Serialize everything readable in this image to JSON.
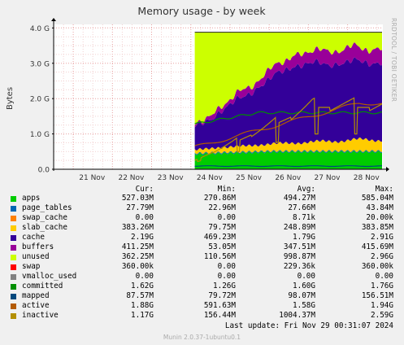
{
  "chart_data": {
    "type": "area",
    "title": "Memory usage - by week",
    "ylabel": "Bytes",
    "ylim": [
      0,
      4.1
    ],
    "y_unit": "G",
    "y_ticks": [
      "0.0",
      "1.0 G",
      "2.0 G",
      "3.0 G",
      "4.0 G"
    ],
    "x_ticks": [
      "21 Nov",
      "22 Nov",
      "23 Nov",
      "24 Nov",
      "25 Nov",
      "26 Nov",
      "27 Nov",
      "28 Nov"
    ],
    "x_range_days": [
      20.5,
      28.9
    ],
    "data_start_day": 24.1,
    "stacked_order": [
      "apps",
      "page_tables",
      "swap_cache",
      "slab_cache",
      "cache",
      "buffers",
      "unused",
      "swap"
    ],
    "line_series": [
      "vmalloc_used",
      "committed",
      "mapped",
      "active",
      "inactive"
    ],
    "total_memory_g": 3.88,
    "grid": true,
    "series": [
      {
        "name": "apps",
        "color": "#00cc00",
        "cur": "527.03M",
        "min": "270.86M",
        "avg": "494.27M",
        "max": "585.04M"
      },
      {
        "name": "page_tables",
        "color": "#0066b3",
        "cur": "27.79M",
        "min": "22.96M",
        "avg": "27.66M",
        "max": "43.84M"
      },
      {
        "name": "swap_cache",
        "color": "#ff8000",
        "cur": "0.00",
        "min": "0.00",
        "avg": "8.71k",
        "max": "20.00k"
      },
      {
        "name": "slab_cache",
        "color": "#ffcc00",
        "cur": "383.26M",
        "min": "79.75M",
        "avg": "248.89M",
        "max": "383.85M"
      },
      {
        "name": "cache",
        "color": "#330099",
        "cur": "2.19G",
        "min": "469.23M",
        "avg": "1.79G",
        "max": "2.91G"
      },
      {
        "name": "buffers",
        "color": "#990099",
        "cur": "411.25M",
        "min": "53.05M",
        "avg": "347.51M",
        "max": "415.69M"
      },
      {
        "name": "unused",
        "color": "#ccff00",
        "cur": "362.25M",
        "min": "110.56M",
        "avg": "998.87M",
        "max": "2.96G"
      },
      {
        "name": "swap",
        "color": "#ff0000",
        "cur": "360.00k",
        "min": "0.00",
        "avg": "229.36k",
        "max": "360.00k"
      },
      {
        "name": "vmalloc_used",
        "color": "#808080",
        "cur": "0.00",
        "min": "0.00",
        "avg": "0.00",
        "max": "0.00"
      },
      {
        "name": "committed",
        "color": "#008f00",
        "cur": "1.62G",
        "min": "1.26G",
        "avg": "1.60G",
        "max": "1.76G"
      },
      {
        "name": "mapped",
        "color": "#00487d",
        "cur": "87.57M",
        "min": "79.72M",
        "avg": "98.07M",
        "max": "156.51M"
      },
      {
        "name": "active",
        "color": "#b35a00",
        "cur": "1.88G",
        "min": "591.63M",
        "avg": "1.58G",
        "max": "1.94G"
      },
      {
        "name": "inactive",
        "color": "#b38f00",
        "cur": "1.17G",
        "min": "156.44M",
        "avg": "1004.37M",
        "max": "2.59G"
      }
    ]
  },
  "legend_headers": {
    "cur": "Cur:",
    "min": "Min:",
    "avg": "Avg:",
    "max": "Max:"
  },
  "last_update": "Last update: Fri Nov 29 00:31:07 2024",
  "footer": "Munin 2.0.37-1ubuntu0.1",
  "side_label": "RRDTOOL / TOBI OETIKER"
}
